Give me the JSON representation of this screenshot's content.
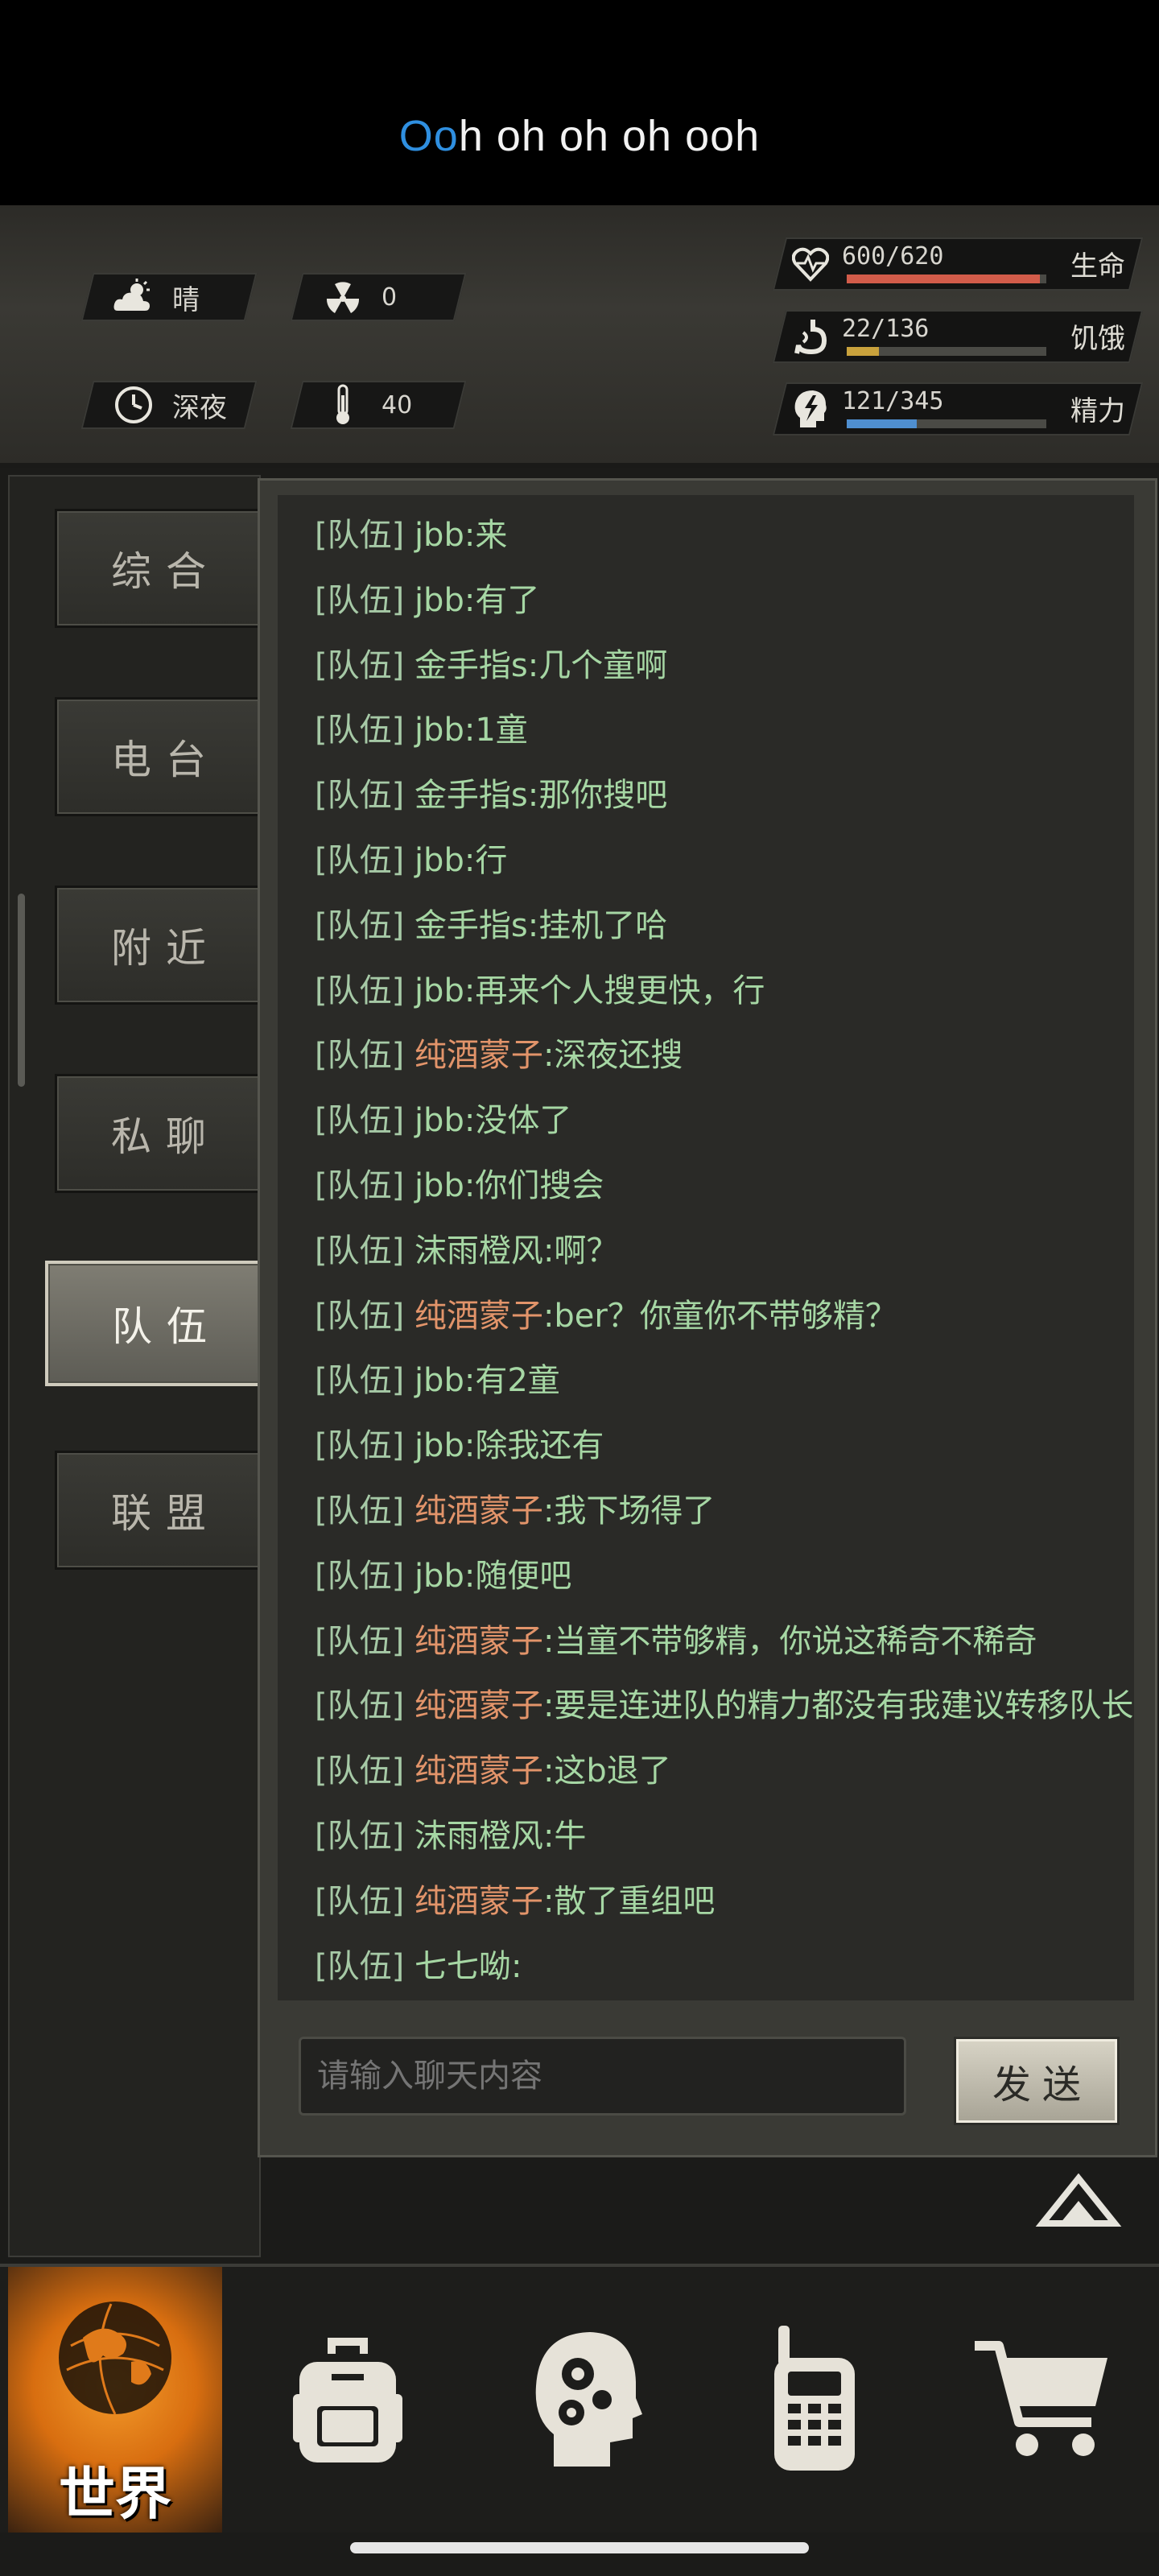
{
  "lyric": {
    "highlight": "Oo",
    "rest": "h oh oh oh ooh"
  },
  "status": {
    "weather": {
      "icon": "partly-cloudy-icon",
      "label": "晴"
    },
    "radiation": {
      "icon": "radiation-icon",
      "value": "0"
    },
    "time": {
      "icon": "clock-icon",
      "label": "深夜"
    },
    "temperature": {
      "icon": "thermometer-icon",
      "value": "40"
    },
    "bars": [
      {
        "key": "health",
        "icon": "heartbeat-icon",
        "value": "600/620",
        "fraction": 0.968,
        "color": "#d25c4a",
        "name": "生命"
      },
      {
        "key": "hunger",
        "icon": "stomach-icon",
        "value": "22/136",
        "fraction": 0.162,
        "color": "#c9a23c",
        "name": "饥饿"
      },
      {
        "key": "energy",
        "icon": "head-bolt-icon",
        "value": "121/345",
        "fraction": 0.351,
        "color": "#4f8fd0",
        "name": "精力"
      }
    ]
  },
  "tabs": [
    {
      "key": "general",
      "label": "综合"
    },
    {
      "key": "radio",
      "label": "电台"
    },
    {
      "key": "nearby",
      "label": "附近"
    },
    {
      "key": "private",
      "label": "私聊"
    },
    {
      "key": "team",
      "label": "队伍",
      "active": true
    },
    {
      "key": "alliance",
      "label": "联盟"
    }
  ],
  "chat": {
    "channel_tag": "[队伍]",
    "messages": [
      {
        "sender": "jbb",
        "text": ":来",
        "sender_color": "green"
      },
      {
        "sender": "jbb",
        "text": ":有了",
        "sender_color": "green"
      },
      {
        "sender": "金手指s",
        "text": ":几个童啊",
        "sender_color": "green"
      },
      {
        "sender": "jbb",
        "text": ":1童",
        "sender_color": "green"
      },
      {
        "sender": "金手指s",
        "text": ":那你搜吧",
        "sender_color": "green"
      },
      {
        "sender": "jbb",
        "text": ":行",
        "sender_color": "green"
      },
      {
        "sender": "金手指s",
        "text": ":挂机了哈",
        "sender_color": "green"
      },
      {
        "sender": "jbb",
        "text": ":再来个人搜更快，行",
        "sender_color": "green"
      },
      {
        "sender": "纯酒蒙子",
        "text": ":深夜还搜",
        "sender_color": "orange"
      },
      {
        "sender": "jbb",
        "text": ":没体了",
        "sender_color": "green"
      },
      {
        "sender": "jbb",
        "text": ":你们搜会",
        "sender_color": "green"
      },
      {
        "sender": "沫雨橙风",
        "text": ":啊？",
        "sender_color": "green"
      },
      {
        "sender": "纯酒蒙子",
        "text": ":ber？你童你不带够精？",
        "sender_color": "orange"
      },
      {
        "sender": "jbb",
        "text": ":有2童",
        "sender_color": "green"
      },
      {
        "sender": "jbb",
        "text": ":除我还有",
        "sender_color": "green"
      },
      {
        "sender": "纯酒蒙子",
        "text": ":我下场得了",
        "sender_color": "orange"
      },
      {
        "sender": "jbb",
        "text": ":随便吧",
        "sender_color": "green"
      },
      {
        "sender": "纯酒蒙子",
        "text": ":当童不带够精，你说这稀奇不稀奇",
        "sender_color": "orange"
      },
      {
        "sender": "纯酒蒙子",
        "text": ":要是连进队的精力都没有我建议转移队长",
        "sender_color": "orange"
      },
      {
        "sender": "纯酒蒙子",
        "text": ":这b退了",
        "sender_color": "orange"
      },
      {
        "sender": "沫雨橙风",
        "text": ":牛",
        "sender_color": "green"
      },
      {
        "sender": "纯酒蒙子",
        "text": ":散了重组吧",
        "sender_color": "orange"
      },
      {
        "sender": "七七呦",
        "text": ":",
        "sender_color": "green"
      }
    ],
    "input_placeholder": "请输入聊天内容",
    "send_label": "发送"
  },
  "bottom_nav": [
    {
      "key": "world",
      "label": "世界",
      "icon": "globe-icon",
      "active": true
    },
    {
      "key": "backpack",
      "label": "",
      "icon": "backpack-icon"
    },
    {
      "key": "skills",
      "label": "",
      "icon": "head-gears-icon"
    },
    {
      "key": "radio",
      "label": "",
      "icon": "walkie-talkie-icon"
    },
    {
      "key": "shop",
      "label": "",
      "icon": "cart-icon"
    }
  ]
}
